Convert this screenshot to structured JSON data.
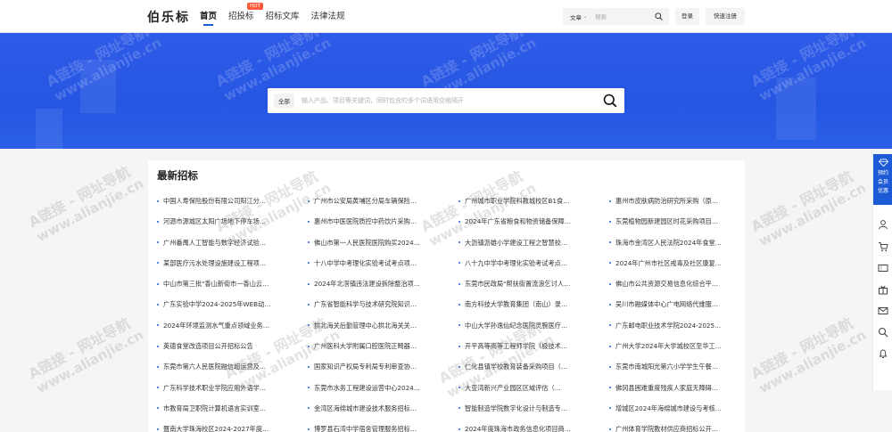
{
  "header": {
    "logo": "伯乐标",
    "nav": [
      {
        "label": "首页",
        "active": true
      },
      {
        "label": "招投标",
        "badge": "HOT"
      },
      {
        "label": "招标文库"
      },
      {
        "label": "法律法规"
      }
    ],
    "search": {
      "type_label": "文章",
      "placeholder": "搜索"
    },
    "login_label": "登录",
    "register_label": "快速注册"
  },
  "hero": {
    "search_tag": "全部",
    "search_placeholder": "输入产品、项目等关键词，同时包含的多个词语用空格隔开"
  },
  "main": {
    "title": "最新招标",
    "items": [
      "中国人寿保险股份有限公司阳江分…",
      "广州市公安局黄埔区分局车辆保险…",
      "广州城市职业学院科教城校区B1食…",
      "惠州市皮肤病防治研究所采购（原…",
      "河源市源城区太阳广场地下停车场…",
      "惠州市中医医院质控中药饮片采购…",
      "2024年广东省粮食和物资储备保障…",
      "东莞植物园新建园区时花采购项目…",
      "广州番禺人工智能与数字经济试验…",
      "佛山市第一人民医院医院购买2024…",
      "大沥镇沥雄小学建设工程之智慧校…",
      "珠海市金湾区人民法院2024年食堂…",
      "某部医疗污水处理设施建设工程项…",
      "十八中学中考理化实验考试考点项…",
      "八十九中学中考理化实验考试考点…",
      "2024年广州市社区戒毒及社区康复…",
      "中山市第三批\"香山新街市一香山云…",
      "2024年北滘镇违法建设拆除整治项…",
      "东莞市民政局\"帮扶街置流浪乞讨人…",
      "佛山市公共资源交易信息化综合平…",
      "广东实验中学2024-2025年WEB动…",
      "广东省智能科学与技术研究院知识…",
      "南方科技大学教育集团（南山）录…",
      "吴川市融媒体中心广电网络代维服…",
      "2024年环境监测水气重点领域业务…",
      "拱北海关后勤管理中心拱北海关关…",
      "中山大学孙逸仙纪念医院灵腕医疗…",
      "广东邮电职业技术学院2024-2025…",
      "英德食堂改造项目公开招标公告",
      "广州医科大学附属口腔医院正畸器…",
      "开平高等高等工程师学院（极技术…",
      "广州大学2024年大学城校区至华工…",
      "东莞市第六人民医院融信超运营及…",
      "国家知识产权局专利局专利审查协…",
      "仁化县镇学校教育装备采购项目（…",
      "东莞市南城阳光第六小学学生午餐…",
      "广东科学技术职业学院应用外语学…",
      "东莞市水务工程建设运营中心2024…",
      "大亚湾新兴产业园区区域评估（…",
      "佛冈县困难重度残疾人家庭无障碍…",
      "市教育局卫职院计算机语言实训室…",
      "金湾区海绵城市建设技术服务招标…",
      "智能制造学院数字化设计与制造专…",
      "增城区2024年海绵城市建设与考核…",
      "暨南大学珠海校区2024-2027年度…",
      "博罗县石湾中学宿舍管理服务招标…",
      "2024年度珠海市政务信息化项目商…",
      "广州体育学院教材供应商招标公开…"
    ]
  },
  "sidebar": {
    "vip_lines": [
      "预约",
      "会员",
      "优惠"
    ],
    "icons": [
      "user-icon",
      "cart-icon",
      "ticket-icon",
      "gift-icon",
      "mail-icon",
      "search-icon",
      "bell-icon"
    ]
  },
  "watermark": {
    "line1": "A链接 - 网址导航",
    "line2": "www.alianjie.cn"
  },
  "colors": {
    "brand": "#1d5ad6",
    "hero": "#2a5be6",
    "hot": "#ff5a3c"
  }
}
